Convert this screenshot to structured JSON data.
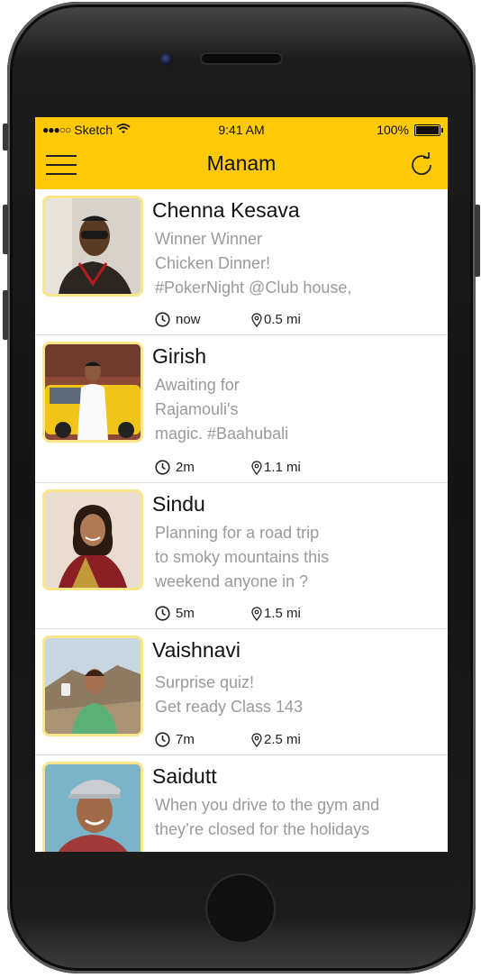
{
  "status": {
    "signal": "●●●○○",
    "carrier": "Sketch",
    "time": "9:41 AM",
    "battery": "100%"
  },
  "nav": {
    "title": "Manam"
  },
  "feed": [
    {
      "name": "Chenna Kesava",
      "lines": [
        "Winner Winner",
        "Chicken Dinner!",
        "#PokerNight @Club house,"
      ],
      "time": "now",
      "distance": "0.5 mi"
    },
    {
      "name": "Girish",
      "lines": [
        "Awaiting for",
        "Rajamouli's",
        "magic. #Baahubali"
      ],
      "time": "2m",
      "distance": "1.1 mi"
    },
    {
      "name": "Sindu",
      "lines": [
        "Planning for a road trip",
        "to smoky mountains this",
        "weekend anyone in ?"
      ],
      "time": "5m",
      "distance": "1.5 mi"
    },
    {
      "name": "Vaishnavi",
      "lines": [
        "Surprise quiz!",
        "Get ready Class 143"
      ],
      "time": "7m",
      "distance": "2.5 mi"
    },
    {
      "name": "Saidutt",
      "lines": [
        "When you drive to the gym and",
        "they’re closed for the holidays"
      ],
      "time": "",
      "distance": ""
    }
  ],
  "colors": {
    "accent": "#ffc906",
    "thumb_border": "#fbe58a",
    "muted_text": "#9a9a9a"
  }
}
